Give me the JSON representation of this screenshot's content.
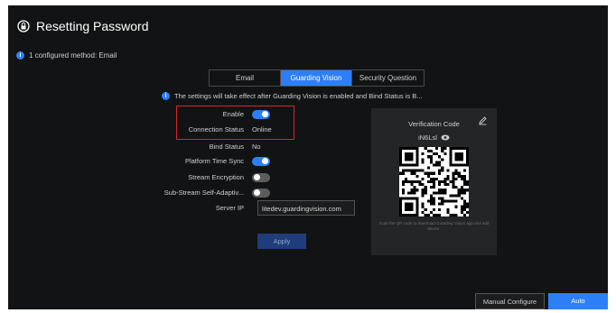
{
  "title": "Resetting Password",
  "configured_method": "1 configured method: Email",
  "tabs": [
    {
      "label": "Email",
      "active": false
    },
    {
      "label": "Guarding Vision",
      "active": true
    },
    {
      "label": "Security Question",
      "active": false
    }
  ],
  "notice": "The settings will take effect after Guarding Vision is enabled and Bind Status is B...",
  "form": {
    "enable_label": "Enable",
    "enable_on": true,
    "connection_status_label": "Connection Status",
    "connection_status_value": "Online",
    "bind_status_label": "Bind Status",
    "bind_status_value": "No",
    "platform_time_sync_label": "Platform Time Sync",
    "platform_time_sync_on": true,
    "stream_encryption_label": "Stream Encryption",
    "stream_encryption_on": false,
    "sub_stream_label": "Sub-Stream Self-Adaptiv...",
    "sub_stream_on": false,
    "server_ip_label": "Server IP",
    "server_ip_value": "litedev.guardingvision.com",
    "apply_label": "Apply"
  },
  "verification": {
    "title": "Verification Code",
    "code": "iN6Lsl",
    "caption": "Scan the QR code to download Guarding Vision app and add device."
  },
  "footer": {
    "manual_label": "Manual Configure",
    "auto_label": "Auto"
  },
  "colors": {
    "accent": "#2d7ff9",
    "highlight": "#e0212b",
    "background": "#121314"
  }
}
